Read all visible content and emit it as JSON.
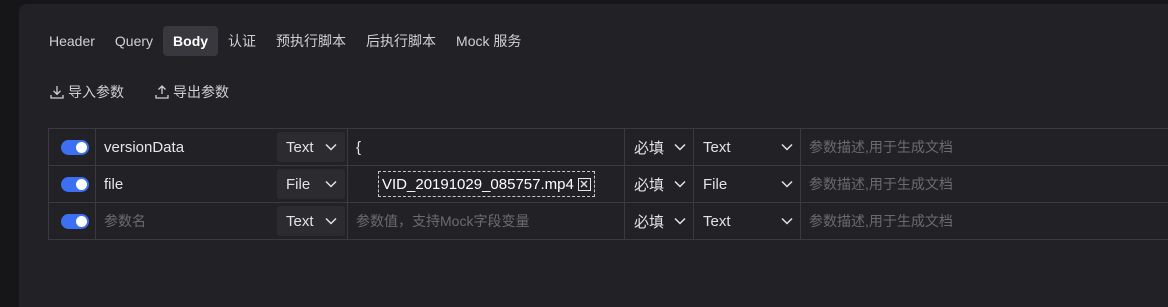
{
  "tabs": [
    {
      "label": "Header",
      "active": false
    },
    {
      "label": "Query",
      "active": false
    },
    {
      "label": "Body",
      "active": true
    },
    {
      "label": "认证",
      "active": false
    },
    {
      "label": "预执行脚本",
      "active": false
    },
    {
      "label": "后执行脚本",
      "active": false
    },
    {
      "label": "Mock 服务",
      "active": false
    }
  ],
  "actions": {
    "import_label": "导入参数",
    "import_icon": "download-icon",
    "export_label": "导出参数",
    "export_icon": "upload-icon"
  },
  "rows": [
    {
      "enabled": true,
      "name": "versionData",
      "param_type": "Text",
      "value": "{",
      "required": "必填",
      "data_type": "Text",
      "description_placeholder": "参数描述,用于生成文档"
    },
    {
      "enabled": true,
      "name": "file",
      "param_type": "File",
      "file_name": "VID_20191029_085757.mp4",
      "required": "必填",
      "data_type": "File",
      "description_placeholder": "参数描述,用于生成文档"
    },
    {
      "enabled": true,
      "name_placeholder": "参数名",
      "param_type": "Text",
      "value_placeholder": "参数值，支持Mock字段变量",
      "required": "必填",
      "data_type": "Text",
      "description_placeholder": "参数描述,用于生成文档"
    }
  ],
  "colors": {
    "toggle_on": "#3d6ff2",
    "active_tab_bg": "#38383e",
    "panel_bg": "#222226"
  }
}
